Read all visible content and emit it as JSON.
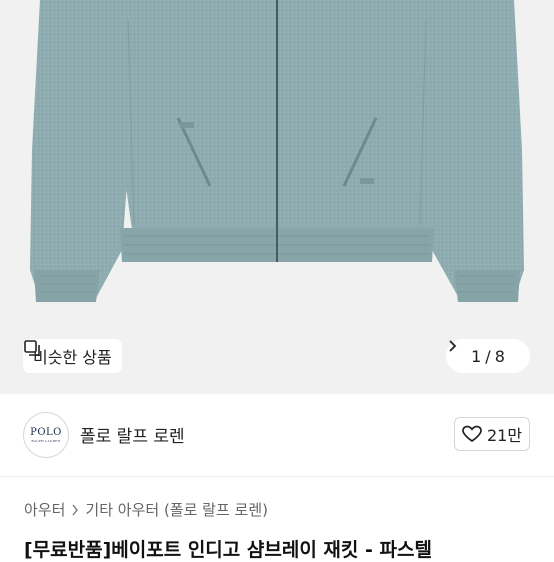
{
  "gallery": {
    "similar_label": "비슷한 상품",
    "current_page": "1",
    "separator": "/",
    "total_pages": "8",
    "jacket_color": "#8fadb1"
  },
  "seller": {
    "logo_text": "POLO",
    "logo_sub": "RALPH LAUREN",
    "name": "폴로 랄프 로렌",
    "likes": "21만"
  },
  "breadcrumb": {
    "level1": "아우터",
    "level2": "기타 아우터 (폴로 랄프 로렌)"
  },
  "product": {
    "title": "[무료반품]베이포트 인디고 샴브레이 재킷 - 파스텔"
  }
}
